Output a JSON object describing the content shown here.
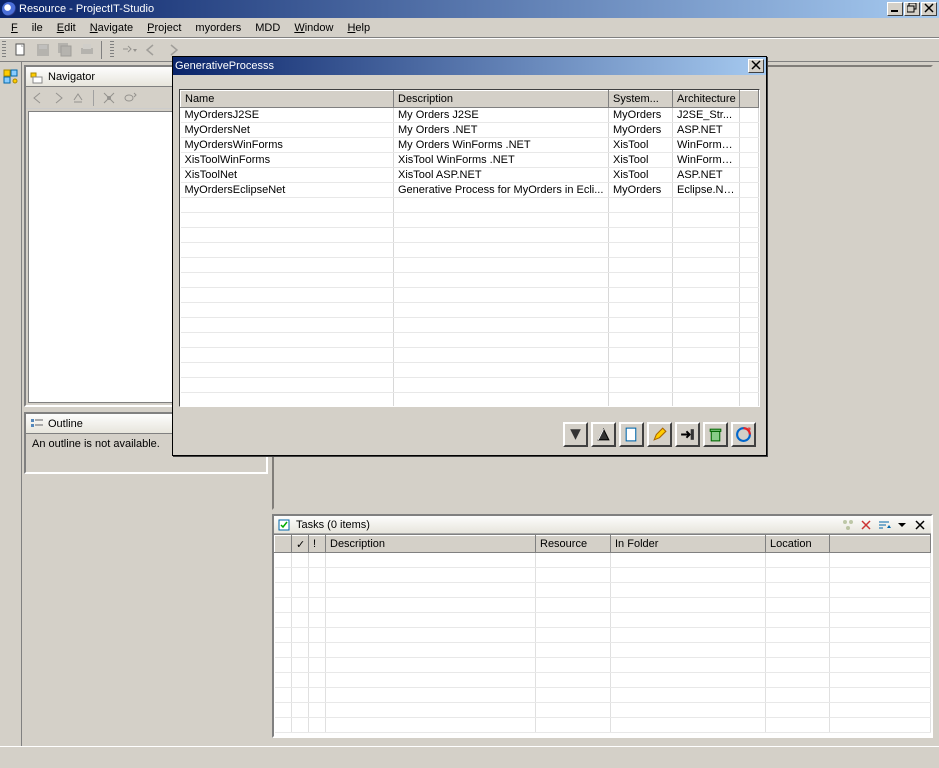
{
  "title": "Resource - ProjectIT-Studio",
  "menu": [
    "File",
    "Edit",
    "Navigate",
    "Project",
    "myorders",
    "MDD",
    "Window",
    "Help"
  ],
  "navigator": {
    "title": "Navigator"
  },
  "outline": {
    "title": "Outline",
    "msg": "An outline is not available."
  },
  "dialog": {
    "title": "GenerativeProcesss",
    "columns": [
      "Name",
      "Description",
      "System...",
      "Architecture"
    ],
    "rows": [
      {
        "name": "MyOrdersJ2SE",
        "desc": "My Orders J2SE",
        "sys": "MyOrders",
        "arch": "J2SE_Str..."
      },
      {
        "name": "MyOrdersNet",
        "desc": "My Orders .NET",
        "sys": "MyOrders",
        "arch": "ASP.NET"
      },
      {
        "name": "MyOrdersWinForms",
        "desc": "My Orders WinForms .NET",
        "sys": "XisTool",
        "arch": "WinForms..."
      },
      {
        "name": "XisToolWinForms",
        "desc": "XisTool WinForms .NET",
        "sys": "XisTool",
        "arch": "WinForms..."
      },
      {
        "name": "XisToolNet",
        "desc": "XisTool ASP.NET",
        "sys": "XisTool",
        "arch": "ASP.NET"
      },
      {
        "name": "MyOrdersEclipseNet",
        "desc": "Generative Process for MyOrders in Ecli...",
        "sys": "MyOrders",
        "arch": "Eclipse.NET"
      }
    ]
  },
  "tasks": {
    "title": "Tasks (0 items)",
    "columns": [
      "",
      "✓",
      "!",
      "Description",
      "Resource",
      "In Folder",
      "Location",
      ""
    ]
  }
}
